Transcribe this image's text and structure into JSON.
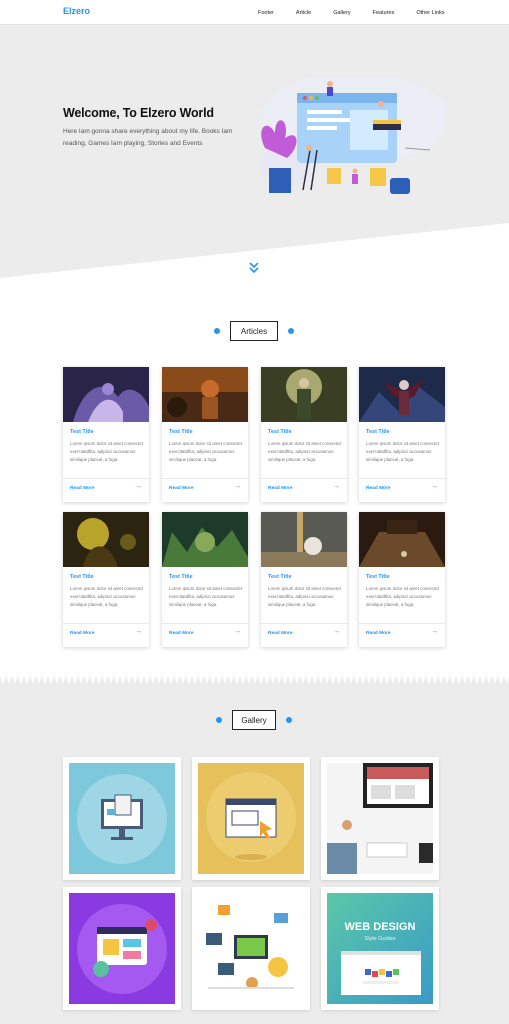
{
  "header": {
    "logo": "Elzero",
    "nav": [
      "Footer",
      "Article",
      "Gallery",
      "Features",
      "Other Links"
    ]
  },
  "hero": {
    "title": "Welcome, To Elzero World",
    "text": "Here Iam gonna share everything about my life. Books Iam reading, Games Iam playing, Stories and Events"
  },
  "articles": {
    "heading": "Articles",
    "cards": [
      {
        "title": "Test Title",
        "text": "Lorem ipsum dolor sit amet consectet exercitatdfita, adipisci accusamus similique placeat, a fuga.",
        "link": "Read More"
      },
      {
        "title": "Test Title",
        "text": "Lorem ipsum dolor sit amet consectet exercitatdfita, adipisci accusamus similique placeat, a fuga.",
        "link": "Read More"
      },
      {
        "title": "Test Title",
        "text": "Lorem ipsum dolor sit amet consectet exercitatdfita, adipisci accusamus similique placeat, a fuga.",
        "link": "Read More"
      },
      {
        "title": "Test Title",
        "text": "Lorem ipsum dolor sit amet consectet exercitatdfita, adipisci accusamus similique placeat, a fuga.",
        "link": "Read More"
      },
      {
        "title": "Test Title",
        "text": "Lorem ipsum dolor sit amet consectet exercitatdfita, adipisci accusamus similique placeat, a fuga.",
        "link": "Read More"
      },
      {
        "title": "Test Title",
        "text": "Lorem ipsum dolor sit amet consectet exercitatdfita, adipisci accusamus similique placeat, a fuga.",
        "link": "Read More"
      },
      {
        "title": "Test Title",
        "text": "Lorem ipsum dolor sit amet consectet exercitatdfita, adipisci accusamus similique placeat, a fuga.",
        "link": "Read More"
      },
      {
        "title": "Test Title",
        "text": "Lorem ipsum dolor sit amet consectet exercitatdfita, adipisci accusamus similique placeat, a fuga.",
        "link": "Read More"
      }
    ]
  },
  "gallery": {
    "heading": "Gallery",
    "web_design_title": "WEB DESIGN",
    "web_design_sub": "Style Guides"
  },
  "colors": {
    "accent": "#2196f3",
    "section_bg": "#ececec"
  },
  "icons": [
    "arrow-right-icon",
    "double-chevron-down-icon"
  ]
}
